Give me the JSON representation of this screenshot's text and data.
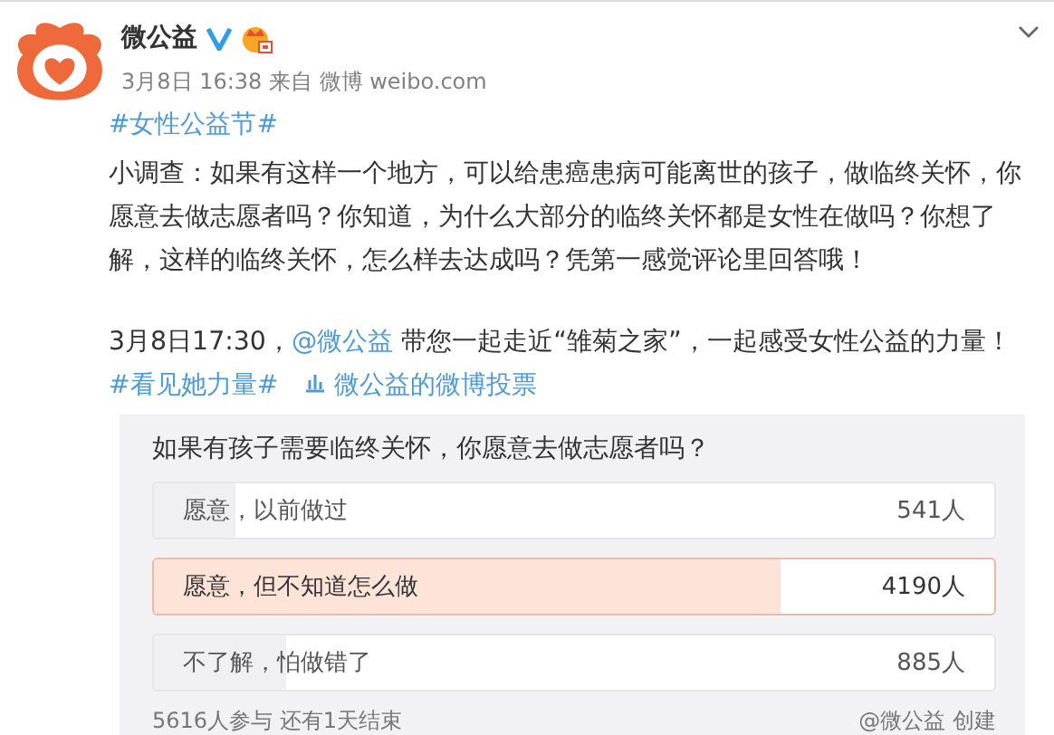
{
  "post": {
    "author": "微公益",
    "verified": true,
    "timestamp": "3月8日 16:38 来自 微博 weibo.com",
    "hashtag": "#女性公益节#",
    "body": "小调查：如果有这样一个地方，可以给患癌患病可能离世的孩子，做临终关怀，你愿意去做志愿者吗？你知道，为什么大部分的临终关怀都是女性在做吗？你想了解，这样的临终关怀，怎么样去达成吗？凭第一感觉评论里回答哦！",
    "event_prefix": "3月8日17:30，",
    "mention": "@微公益",
    "event_text": "带您一起走近“雏菊之家”，一起感受女性公益的力量！",
    "event_hashtag": "#看见她力量#",
    "vote_link": "微公益的微博投票"
  },
  "poll": {
    "question": "如果有孩子需要临终关怀，你愿意去做志愿者吗？",
    "options": [
      {
        "label": "愿意，以前做过",
        "count": "541人",
        "level": 0.096,
        "selected": false
      },
      {
        "label": "愿意，但不知道怎么做",
        "count": "4190人",
        "level": 0.746,
        "selected": true
      },
      {
        "label": "不了解，怕做错了",
        "count": "885人",
        "level": 0.158,
        "selected": false
      }
    ],
    "summary": "5616人参与 还有1天结束",
    "creator": "@微公益 创建"
  }
}
